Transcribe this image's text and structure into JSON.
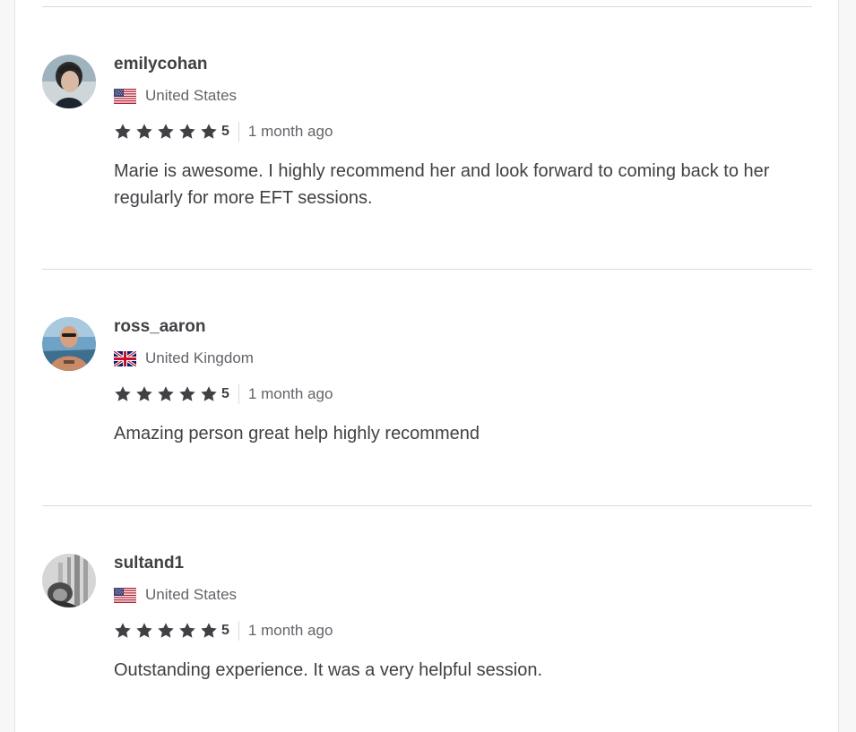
{
  "reviews": [
    {
      "username": "emilycohan",
      "country": "United States",
      "flag": "us-flag",
      "rating": "5",
      "time": "1 month ago",
      "text": "Marie is awesome. I highly recommend her and look forward to coming back to her regularly for more EFT sessions."
    },
    {
      "username": "ross_aaron",
      "country": "United Kingdom",
      "flag": "uk-flag",
      "rating": "5",
      "time": "1 month ago",
      "text": "Amazing person great help highly recommend"
    },
    {
      "username": "sultand1",
      "country": "United States",
      "flag": "us-flag",
      "rating": "5",
      "time": "1 month ago",
      "text": "Outstanding experience. It was a very helpful session."
    }
  ],
  "colors": {
    "star": "#404145",
    "text": "#404145",
    "muted": "#62646a",
    "divider": "#dadbdd"
  }
}
